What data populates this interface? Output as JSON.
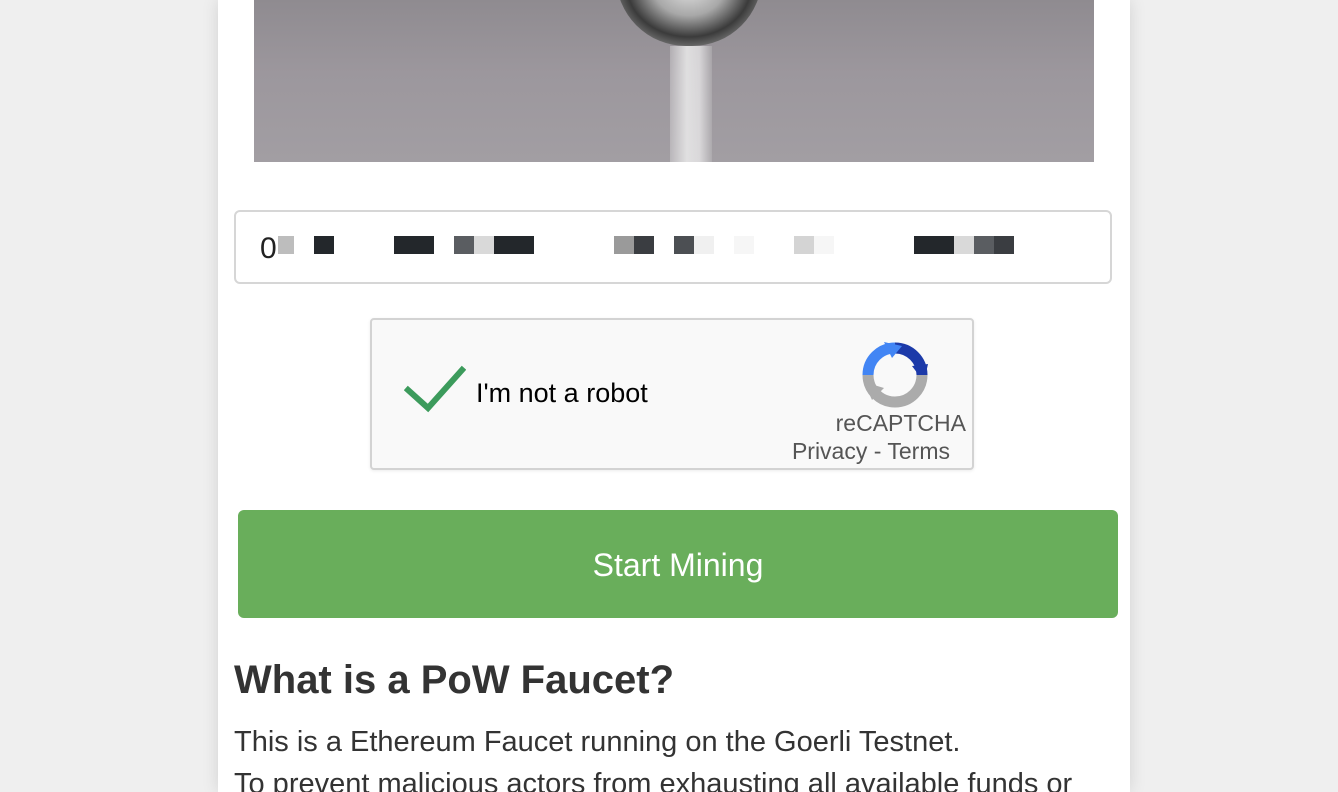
{
  "address_input": {
    "value_visible": "0"
  },
  "recaptcha": {
    "label": "I'm not a robot",
    "brand": "reCAPTCHA",
    "privacy_link": "Privacy",
    "separator": " - ",
    "terms_link": "Terms",
    "checked": true,
    "check_color": "#3c9b5c"
  },
  "start_button": {
    "label": "Start Mining",
    "color": "#69ae5b"
  },
  "about": {
    "heading": "What is a PoW Faucet?",
    "line1": "This is a Ethereum Faucet running on the Goerli Testnet.",
    "line2": "To prevent malicious actors from exhausting all available funds or"
  },
  "icons": {
    "hero": "faucet-image",
    "check": "checkmark-icon",
    "recaptcha": "recaptcha-logo-icon"
  }
}
